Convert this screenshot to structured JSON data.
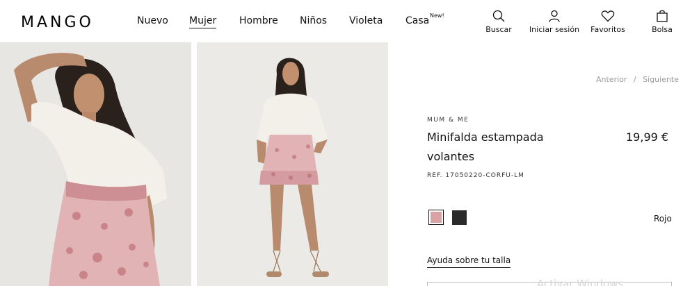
{
  "header": {
    "logo": "MANGO",
    "nav": [
      {
        "label": "Nuevo"
      },
      {
        "label": "Mujer"
      },
      {
        "label": "Hombre"
      },
      {
        "label": "Niños"
      },
      {
        "label": "Violeta"
      },
      {
        "label": "Casa"
      }
    ],
    "new_badge": "New!",
    "utilities": {
      "search": "Buscar",
      "login": "Iniciar sesión",
      "favorites": "Favoritos",
      "bag": "Bolsa"
    }
  },
  "pager": {
    "previous": "Anterior",
    "separator": "/",
    "next": "Siguiente"
  },
  "product": {
    "brand": "MUM & ME",
    "title": "Minifalda estampada volantes",
    "price": "19,99 €",
    "ref": "REF. 17050220-CORFU-LM",
    "color_name": "Rojo",
    "size_help": "Ayuda sobre tu talla"
  },
  "colors": {
    "swatch_red": "#d9a3a6",
    "swatch_black": "#2a2a2a"
  },
  "overlay": {
    "watermark": "Activar Windows"
  }
}
